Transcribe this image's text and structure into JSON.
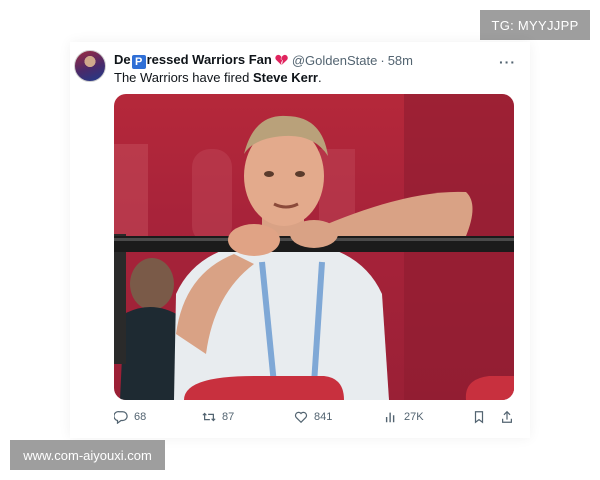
{
  "watermarks": {
    "top": "TG: MYYJJPP",
    "bottom": "www.com-aiyouxi.com"
  },
  "tweet": {
    "author": {
      "name_prefix": "De",
      "name_badge_letter": "P",
      "name_suffix": "ressed Warriors Fan",
      "handle": "@GoldenState",
      "time": "58m"
    },
    "text_prefix": "The Warriors have fired ",
    "text_bold": "Steve Kerr",
    "text_suffix": ".",
    "media": {
      "background_color": "#a8233a",
      "description_icon": "photo"
    },
    "actions": {
      "replies": "68",
      "retweets": "87",
      "likes": "841",
      "views": "27K"
    }
  },
  "colors": {
    "accent": "#1d9bf0",
    "muted": "#536471",
    "heart": "#e0245e"
  }
}
